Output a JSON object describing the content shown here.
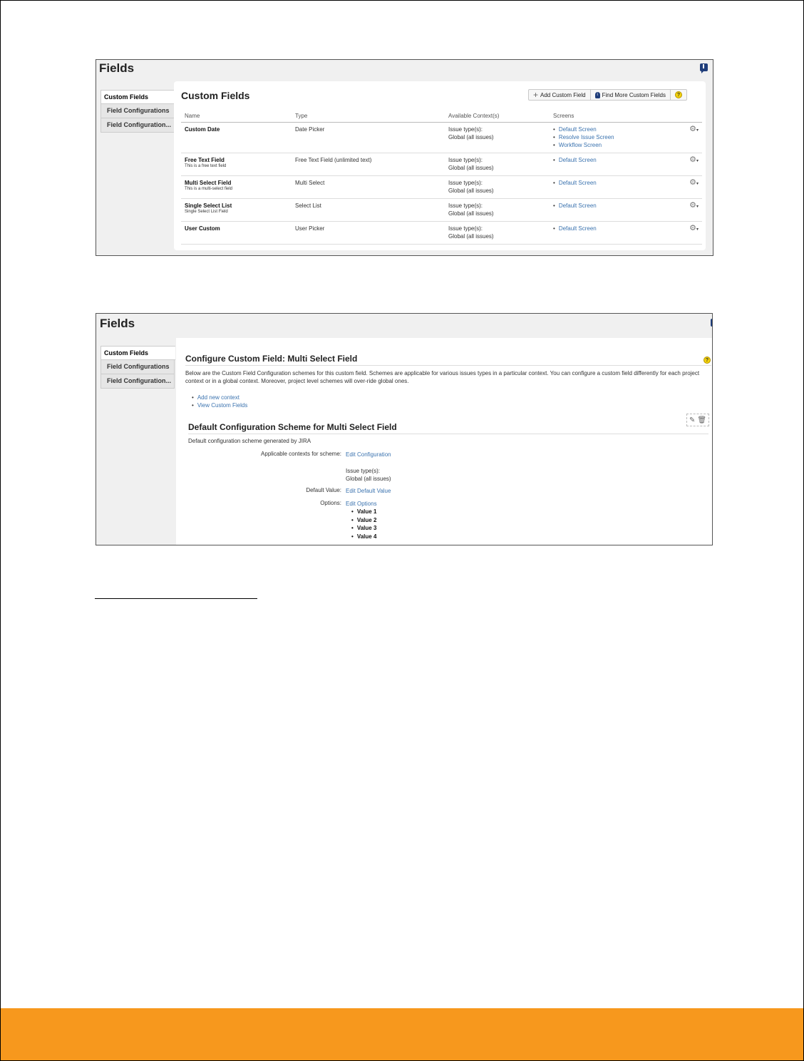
{
  "panel1": {
    "fields_title": "Fields",
    "sidebar": [
      "Custom Fields",
      "Field Configurations",
      "Field Configuration..."
    ],
    "heading": "Custom Fields",
    "toolbar": {
      "add_label": "Add Custom Field",
      "find_label": "Find More Custom Fields",
      "help_glyph": "?"
    },
    "columns": [
      "Name",
      "Type",
      "Available Context(s)",
      "Screens"
    ],
    "rows": [
      {
        "name": "Custom Date",
        "desc": "",
        "type": "Date Picker",
        "ctx1": "Issue type(s):",
        "ctx2": "Global (all issues)",
        "screens": [
          "Default Screen",
          "Resolve Issue Screen",
          "Workflow Screen"
        ]
      },
      {
        "name": "Free Text Field",
        "desc": "This is a free text field",
        "type": "Free Text Field (unlimited text)",
        "ctx1": "Issue type(s):",
        "ctx2": "Global (all issues)",
        "screens": [
          "Default Screen"
        ]
      },
      {
        "name": "Multi Select Field",
        "desc": "This is a multi-select field",
        "type": "Multi Select",
        "ctx1": "Issue type(s):",
        "ctx2": "Global (all issues)",
        "screens": [
          "Default Screen"
        ]
      },
      {
        "name": "Single Select List",
        "desc": "Single Select List Field",
        "type": "Select List",
        "ctx1": "Issue type(s):",
        "ctx2": "Global (all issues)",
        "screens": [
          "Default Screen"
        ]
      },
      {
        "name": "User Custom",
        "desc": "",
        "type": "User Picker",
        "ctx1": "Issue type(s):",
        "ctx2": "Global (all issues)",
        "screens": [
          "Default Screen"
        ]
      }
    ]
  },
  "panel2": {
    "fields_title": "Fields",
    "sidebar": [
      "Custom Fields",
      "Field Configurations",
      "Field Configuration..."
    ],
    "heading": "Configure Custom Field: Multi Select Field",
    "help_glyph": "?",
    "description": "Below are the Custom Field Configuration schemes for this custom field. Schemes are applicable for various issues types in a particular context. You can configure a custom field differently for each project context or in a global context. Moreover, project level schemes will over-ride global ones.",
    "links": [
      "Add new context",
      "View Custom Fields"
    ],
    "scheme_heading": "Default Configuration Scheme for Multi Select Field",
    "scheme_desc": "Default configuration scheme generated by JIRA",
    "contexts_label": "Applicable contexts for scheme:",
    "edit_configuration": "Edit Configuration",
    "issue_types_label": "Issue type(s):",
    "issue_types_value": "Global (all issues)",
    "default_value_label": "Default Value:",
    "edit_default_value": "Edit Default Value",
    "options_label": "Options:",
    "edit_options": "Edit Options",
    "options": [
      "Value 1",
      "Value 2",
      "Value 3",
      "Value 4"
    ]
  },
  "colors": {
    "footer": "#f7981d",
    "link": "#3b73af",
    "feedback_icon": "#1f3d7a"
  },
  "icons": [
    "feedback-icon",
    "plus-icon",
    "find-icon",
    "help-icon",
    "gear-icon",
    "edit-icon",
    "trash-icon"
  ]
}
